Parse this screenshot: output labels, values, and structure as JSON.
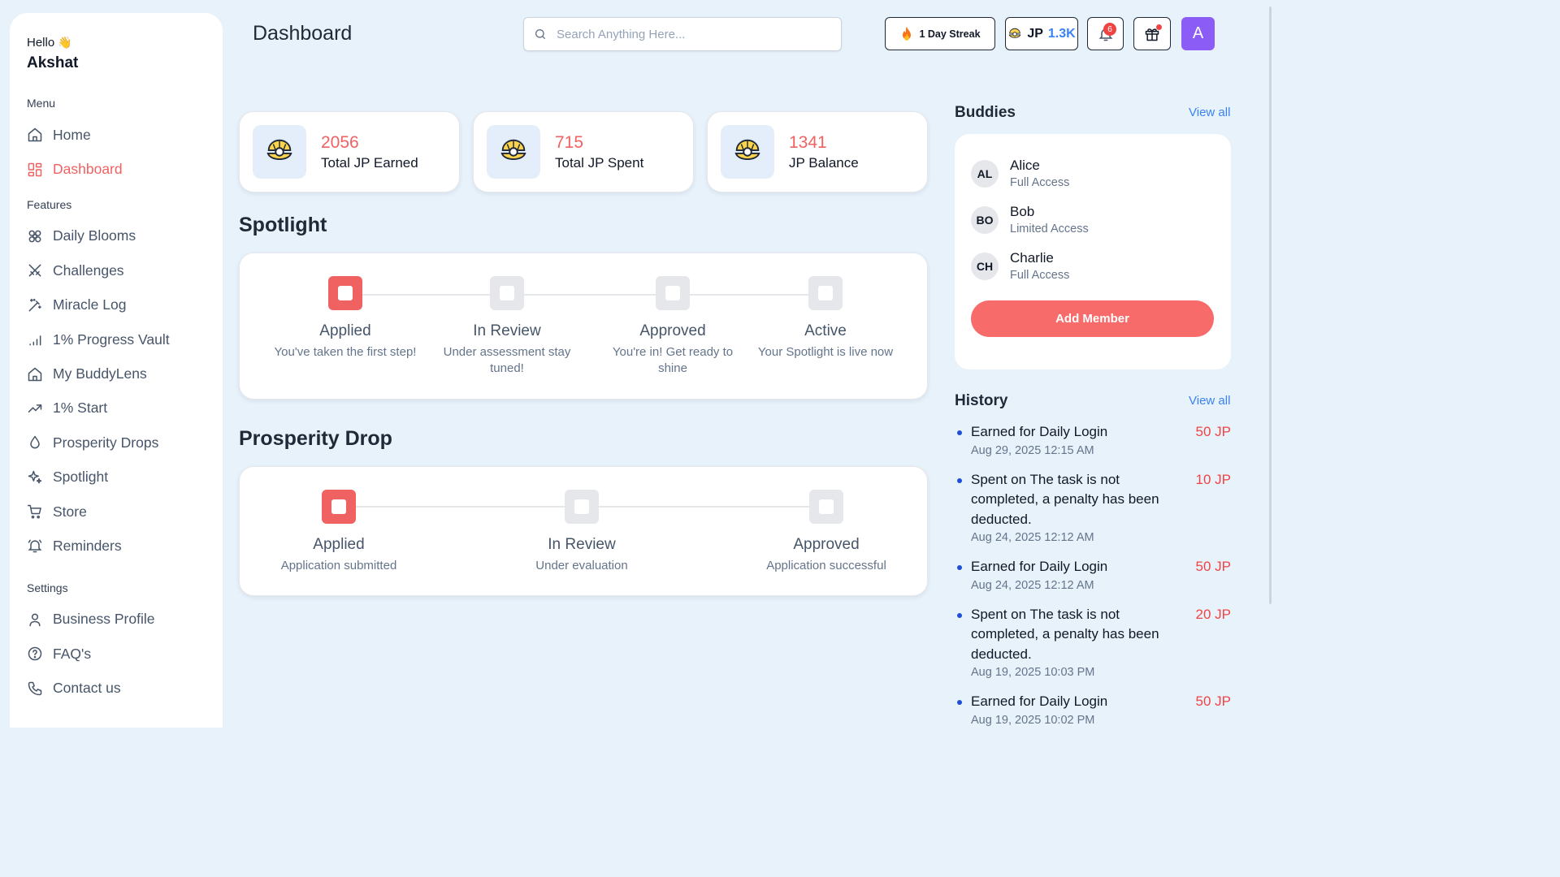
{
  "sidebar": {
    "greeting": "Hello",
    "wave": "👋",
    "user_name": "Akshat",
    "menu_label": "Menu",
    "menu_items": [
      {
        "label": "Home",
        "icon": "home-icon"
      },
      {
        "label": "Dashboard",
        "icon": "dashboard-icon",
        "active": true
      }
    ],
    "features_label": "Features",
    "feature_items": [
      {
        "label": "Daily Blooms",
        "icon": "flower-icon"
      },
      {
        "label": "Challenges",
        "icon": "swords-icon"
      },
      {
        "label": "Miracle Log",
        "icon": "magic-wand-icon"
      },
      {
        "label": "1% Progress Vault",
        "icon": "signal-bars-icon"
      },
      {
        "label": "My BuddyLens",
        "icon": "house-icon"
      },
      {
        "label": "1% Start",
        "icon": "trending-up-icon"
      },
      {
        "label": "Prosperity Drops",
        "icon": "droplet-icon"
      },
      {
        "label": "Spotlight",
        "icon": "sparkles-icon"
      },
      {
        "label": "Store",
        "icon": "cart-icon"
      },
      {
        "label": "Reminders",
        "icon": "bell-ring-icon"
      }
    ],
    "settings_label": "Settings",
    "settings_items": [
      {
        "label": "Business Profile",
        "icon": "user-icon"
      },
      {
        "label": "FAQ's",
        "icon": "help-circle-icon"
      },
      {
        "label": "Contact us",
        "icon": "phone-icon"
      }
    ]
  },
  "header": {
    "title": "Dashboard",
    "search_placeholder": "Search Anything Here...",
    "streak_label": "1 Day Streak",
    "jp_label": "JP",
    "jp_value": "1.3K",
    "notification_count": "6",
    "avatar_letter": "A"
  },
  "stats": [
    {
      "value": "2056",
      "label": "Total JP Earned"
    },
    {
      "value": "715",
      "label": "Total JP Spent"
    },
    {
      "value": "1341",
      "label": "JP Balance"
    }
  ],
  "spotlight": {
    "title": "Spotlight",
    "steps": [
      {
        "label": "Applied",
        "desc": "You've taken the first step!",
        "active": true
      },
      {
        "label": "In Review",
        "desc": "Under assessment stay tuned!",
        "active": false
      },
      {
        "label": "Approved",
        "desc": "You're in! Get ready to shine",
        "active": false
      },
      {
        "label": "Active",
        "desc": "Your Spotlight is live now",
        "active": false
      }
    ]
  },
  "prosperity": {
    "title": "Prosperity Drop",
    "steps": [
      {
        "label": "Applied",
        "desc": "Application submitted",
        "active": true
      },
      {
        "label": "In Review",
        "desc": "Under evaluation",
        "active": false
      },
      {
        "label": "Approved",
        "desc": "Application successful",
        "active": false
      }
    ]
  },
  "buddies": {
    "title": "Buddies",
    "view_all": "View all",
    "items": [
      {
        "initials": "AL",
        "name": "Alice",
        "access": "Full Access"
      },
      {
        "initials": "BO",
        "name": "Bob",
        "access": "Limited Access"
      },
      {
        "initials": "CH",
        "name": "Charlie",
        "access": "Full Access"
      }
    ],
    "add_button": "Add Member"
  },
  "history": {
    "title": "History",
    "view_all": "View all",
    "items": [
      {
        "title": "Earned for Daily Login",
        "date": "Aug 29, 2025 12:15 AM",
        "amount": "50 JP"
      },
      {
        "title": "Spent on The task is not completed, a penalty has been deducted.",
        "date": "Aug 24, 2025 12:12 AM",
        "amount": "10 JP"
      },
      {
        "title": "Earned for Daily Login",
        "date": "Aug 24, 2025 12:12 AM",
        "amount": "50 JP"
      },
      {
        "title": "Spent on The task is not completed, a penalty has been deducted.",
        "date": "Aug 19, 2025 10:03 PM",
        "amount": "20 JP"
      },
      {
        "title": "Earned for Daily Login",
        "date": "Aug 19, 2025 10:02 PM",
        "amount": "50 JP"
      }
    ]
  }
}
